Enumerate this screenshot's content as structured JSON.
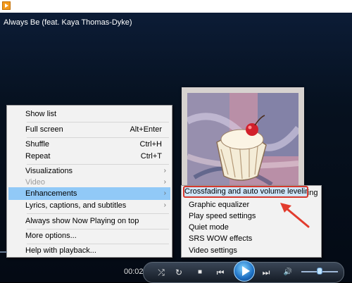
{
  "window": {
    "song_title": "Always Be (feat. Kaya Thomas-Dyke)"
  },
  "main_menu": {
    "items": [
      {
        "label": "Show list"
      },
      {
        "label": "Full screen",
        "shortcut": "Alt+Enter"
      },
      {
        "label": "Shuffle",
        "shortcut": "Ctrl+H"
      },
      {
        "label": "Repeat",
        "shortcut": "Ctrl+T"
      },
      {
        "label": "Visualizations",
        "arrow": "›"
      },
      {
        "label": "Video",
        "arrow": "›"
      },
      {
        "label": "Enhancements",
        "arrow": "›"
      },
      {
        "label": "Lyrics, captions, and subtitles",
        "arrow": "›"
      },
      {
        "label": "Always show Now Playing on top"
      },
      {
        "label": "More options..."
      },
      {
        "label": "Help with playback..."
      }
    ]
  },
  "enhancements_menu": {
    "items": [
      {
        "label": "Crossfading and auto volume leveling"
      },
      {
        "label": "Graphic equalizer"
      },
      {
        "label": "Play speed settings"
      },
      {
        "label": "Quiet mode"
      },
      {
        "label": "SRS WOW effects"
      },
      {
        "label": "Video settings"
      }
    ]
  },
  "controls": {
    "time": "00:02",
    "icons": {
      "shuffle": "⤮",
      "repeat": "↻",
      "stop": "■",
      "prev": "⏮",
      "next": "⏭",
      "volume": "🔊"
    }
  },
  "colors": {
    "highlight": "#91c9f7",
    "annotation": "#d6382d",
    "background": "#06111f"
  }
}
